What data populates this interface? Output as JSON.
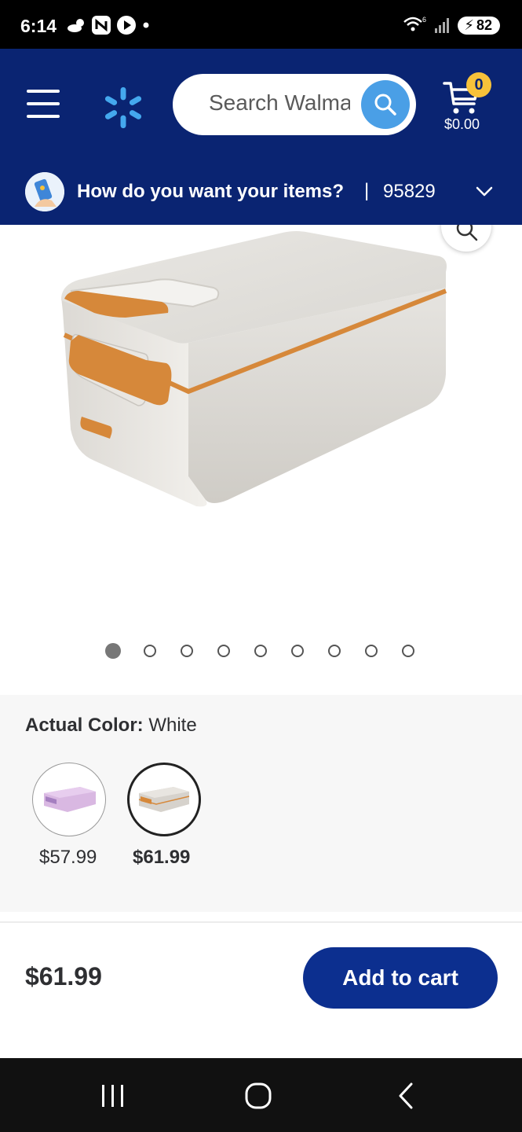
{
  "status_bar": {
    "time": "6:14",
    "wifi_label": "6",
    "battery": "82"
  },
  "header": {
    "search_placeholder": "Search Walmart",
    "cart_count": "0",
    "cart_total": "$0.00"
  },
  "delivery": {
    "question": "How do you want your items?",
    "separator": "|",
    "zip": "95829"
  },
  "gallery": {
    "image_count": 9,
    "active_index": 0
  },
  "variant": {
    "label": "Actual Color:",
    "value": "White",
    "options": [
      {
        "color": "purple",
        "price": "$57.99",
        "selected": false
      },
      {
        "color": "white",
        "price": "$61.99",
        "selected": true
      }
    ]
  },
  "purchase": {
    "price": "$61.99",
    "add_to_cart_label": "Add to cart"
  },
  "colors": {
    "header_bg": "#0a2472",
    "search_btn": "#4a9fe6",
    "badge": "#f7c23a",
    "cta": "#0c2f8f",
    "spark": "#44a8ee",
    "accent_orange": "#d6883a"
  },
  "icons": [
    "menu-icon",
    "walmart-spark-icon",
    "search-icon",
    "cart-icon",
    "chevron-down-icon",
    "zoom-icon",
    "nav-recents-icon",
    "nav-home-icon",
    "nav-back-icon"
  ]
}
